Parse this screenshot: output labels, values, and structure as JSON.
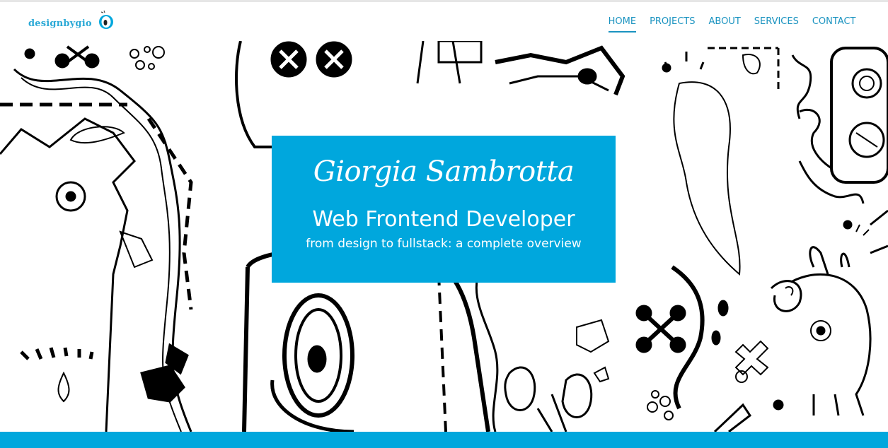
{
  "brand": {
    "logo_text": "designbygio",
    "logo_icon": "cartoon-eye-icon",
    "accent_color": "#00a7dd",
    "nav_color": "#1a93c0"
  },
  "nav": {
    "items": [
      {
        "label": "HOME",
        "active": true
      },
      {
        "label": "PROJECTS",
        "active": false
      },
      {
        "label": "ABOUT",
        "active": false
      },
      {
        "label": "SERVICES",
        "active": false
      },
      {
        "label": "CONTACT",
        "active": false
      }
    ]
  },
  "hero": {
    "background": "black-and-white doodle illustration",
    "name": "Giorgia Sambrotta",
    "role": "Web Frontend Developer",
    "tagline": "from design to fullstack: a complete overview"
  }
}
